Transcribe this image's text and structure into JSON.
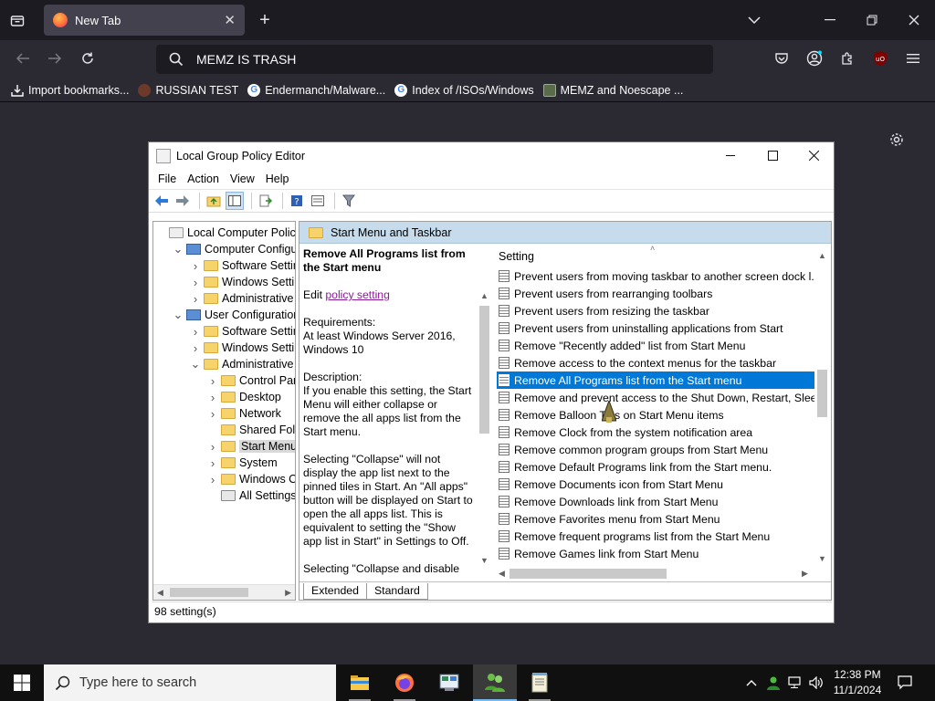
{
  "browser": {
    "tab_title": "New Tab",
    "url_text": "MEMZ IS TRASH",
    "bookmarks": [
      {
        "label": "Import bookmarks...",
        "icon": "import-icon"
      },
      {
        "label": "RUSSIAN TEST",
        "icon": "russian-test-icon"
      },
      {
        "label": "Endermanch/Malware...",
        "icon": "google-icon"
      },
      {
        "label": "Index of /ISOs/Windows",
        "icon": "google-icon"
      },
      {
        "label": "MEMZ and Noescape ...",
        "icon": "image-icon"
      }
    ]
  },
  "gpedit": {
    "title": "Local Group Policy Editor",
    "menu": [
      "File",
      "Action",
      "View",
      "Help"
    ],
    "tree": [
      {
        "label": "Local Computer Policy",
        "indent": 0,
        "expander": "",
        "icon": "policy"
      },
      {
        "label": "Computer Configura",
        "indent": 1,
        "expander": "v",
        "icon": "pc"
      },
      {
        "label": "Software Settings",
        "indent": 2,
        "expander": ">",
        "icon": "folder"
      },
      {
        "label": "Windows Setting",
        "indent": 2,
        "expander": ">",
        "icon": "folder"
      },
      {
        "label": "Administrative Te",
        "indent": 2,
        "expander": ">",
        "icon": "folder"
      },
      {
        "label": "User Configuration",
        "indent": 1,
        "expander": "v",
        "icon": "pc"
      },
      {
        "label": "Software Settings",
        "indent": 2,
        "expander": ">",
        "icon": "folder"
      },
      {
        "label": "Windows Setting",
        "indent": 2,
        "expander": ">",
        "icon": "folder"
      },
      {
        "label": "Administrative Te",
        "indent": 2,
        "expander": "v",
        "icon": "folder"
      },
      {
        "label": "Control Panel",
        "indent": 3,
        "expander": ">",
        "icon": "folder"
      },
      {
        "label": "Desktop",
        "indent": 3,
        "expander": ">",
        "icon": "folder"
      },
      {
        "label": "Network",
        "indent": 3,
        "expander": ">",
        "icon": "folder"
      },
      {
        "label": "Shared Folder",
        "indent": 3,
        "expander": "",
        "icon": "folder"
      },
      {
        "label": "Start Menu ar",
        "indent": 3,
        "expander": ">",
        "icon": "folder",
        "selected": true
      },
      {
        "label": "System",
        "indent": 3,
        "expander": ">",
        "icon": "folder"
      },
      {
        "label": "Windows Cor",
        "indent": 3,
        "expander": ">",
        "icon": "folder"
      },
      {
        "label": "All Settings",
        "indent": 3,
        "expander": "",
        "icon": "settings"
      }
    ],
    "folder_header": "Start Menu and Taskbar",
    "description": {
      "title": "Remove All Programs list from the Start menu",
      "edit_prefix": "Edit ",
      "edit_link": "policy setting",
      "requirements_label": "Requirements:",
      "requirements": "At least Windows Server 2016, Windows 10",
      "description_label": "Description:",
      "para1": "If you enable this setting, the Start Menu will either collapse or remove the all apps list from the Start menu.",
      "para2": "Selecting \"Collapse\" will not display the app list next to the pinned tiles in Start. An \"All apps\" button will be displayed on Start to open the all apps list. This is equivalent to setting the \"Show app list in Start\" in Settings to Off.",
      "para3": "Selecting \"Collapse and disable"
    },
    "column_header": "Setting",
    "settings": [
      "Prevent users from moving taskbar to another screen dock l...",
      "Prevent users from rearranging toolbars",
      "Prevent users from resizing the taskbar",
      "Prevent users from uninstalling applications from Start",
      "Remove \"Recently added\" list from Start Menu",
      "Remove access to the context menus for the taskbar",
      "Remove All Programs list from the Start menu",
      "Remove and prevent access to the Shut Down, Restart, Sleep...",
      "Remove Balloon Tips on Start Menu items",
      "Remove Clock from the system notification area",
      "Remove common program groups from Start Menu",
      "Remove Default Programs link from the Start menu.",
      "Remove Documents icon from Start Menu",
      "Remove Downloads link from Start Menu",
      "Remove Favorites menu from Start Menu",
      "Remove frequent programs list from the Start Menu",
      "Remove Games link from Start Menu"
    ],
    "selected_setting_index": 6,
    "tabs": [
      "Extended",
      "Standard"
    ],
    "status": "98 setting(s)"
  },
  "taskbar": {
    "search_placeholder": "Type here to search",
    "time": "12:38 PM",
    "date": "11/1/2024"
  },
  "colors": {
    "accent": "#0078d7",
    "firefox_dark": "#1c1b22",
    "header_blue": "#c6dbec"
  }
}
